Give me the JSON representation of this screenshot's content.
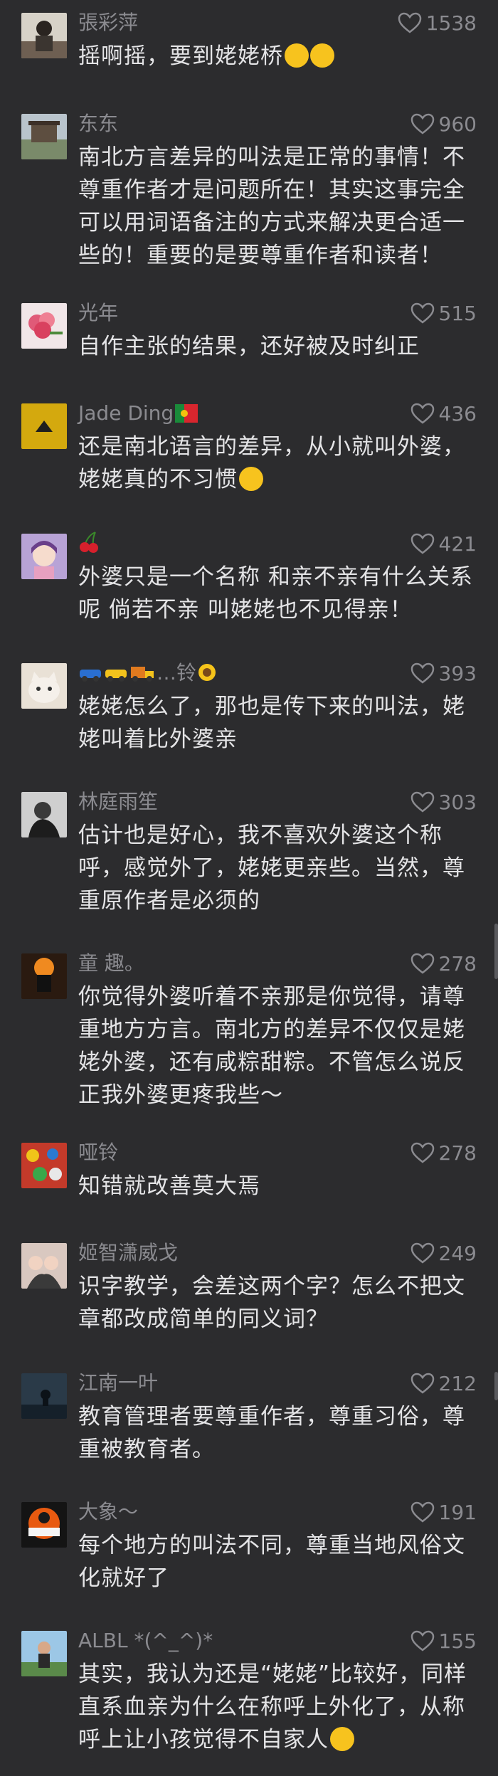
{
  "comments": [
    {
      "name": "張彩萍",
      "likes": "1538",
      "text": "摇啊摇，要到姥姥桥",
      "emoji": [
        "crying-laughing-emoji",
        "crying-laughing-emoji"
      ]
    },
    {
      "name": "东东",
      "likes": "960",
      "text": "南北方言差异的叫法是正常的事情！不尊重作者才是问题所在！其实这事完全可以用词语备注的方式来解决更合适一些的！重要的是要尊重作者和读者！"
    },
    {
      "name": "光年",
      "likes": "515",
      "text": "自作主张的结果，还好被及时纠正"
    },
    {
      "name": "Jade Ding",
      "name_emoji": "portugal-flag-emoji",
      "likes": "436",
      "text": "还是南北语言的差异，从小就叫外婆，姥姥真的不习惯",
      "emoji": [
        "pleading-face-emoji"
      ]
    },
    {
      "name": "",
      "name_emoji": "cherries-emoji",
      "likes": "421",
      "text": "外婆只是一个名称 和亲不亲有什么关系呢 倘若不亲 叫姥姥也不见得亲！"
    },
    {
      "name": "…铃",
      "name_emoji_prefix": [
        "car-emoji",
        "taxi-emoji",
        "truck-emoji"
      ],
      "name_emoji": "sunflower-emoji",
      "likes": "393",
      "text": "姥姥怎么了，那也是传下来的叫法，姥姥叫着比外婆亲"
    },
    {
      "name": "林庭雨笙",
      "likes": "303",
      "text": "估计也是好心，我不喜欢外婆这个称呼，感觉外了，姥姥更亲些。当然，尊重原作者是必须的"
    },
    {
      "name": "童 趣。",
      "likes": "278",
      "text": "你觉得外婆听着不亲那是你觉得，请尊重地方方言。南北方的差异不仅仅是姥姥外婆，还有咸粽甜粽。不管怎么说反正我外婆更疼我些～"
    },
    {
      "name": "哑铃",
      "likes": "278",
      "text": "知错就改善莫大焉"
    },
    {
      "name": "姬智潇威戈",
      "likes": "249",
      "text": "识字教学，会差这两个字？怎么不把文章都改成简单的同义词？"
    },
    {
      "name": "江南一叶",
      "likes": "212",
      "text": "教育管理者要尊重作者，尊重习俗，尊重被教育者。"
    },
    {
      "name": "大象～",
      "likes": "191",
      "text": "每个地方的叫法不同，尊重当地风俗文化就好了"
    },
    {
      "name": "ALBL *(^_^)*",
      "likes": "155",
      "text": "其实，我认为还是“姥姥”比较好，同样直系血亲为什么在称呼上外化了，从称呼上让小孩觉得不自家人",
      "emoji": [
        "flushed-face-emoji"
      ]
    }
  ]
}
